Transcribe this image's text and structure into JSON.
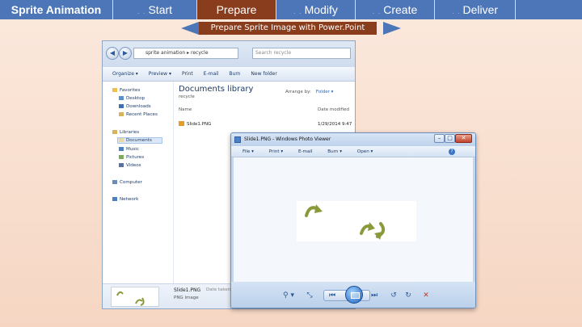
{
  "nav": {
    "title": "Sprite Animation",
    "tabs": [
      {
        "label": "Start",
        "active": false
      },
      {
        "label": "Prepare",
        "active": true
      },
      {
        "label": "Modify",
        "active": false
      },
      {
        "label": "Create",
        "active": false
      },
      {
        "label": "Deliver",
        "active": false
      }
    ],
    "subtitle": "Prepare Sprite Image with Power.Point"
  },
  "explorer": {
    "address": "sprite animation  ▸  recycle",
    "search_placeholder": "Search recycle",
    "toolbar": [
      "Organize ▾",
      "Preview ▾",
      "Print",
      "E-mail",
      "Burn",
      "New folder"
    ],
    "favorites": "Favorites",
    "favorites_items": [
      "Desktop",
      "Downloads",
      "Recent Places"
    ],
    "libraries": "Libraries",
    "libraries_items": [
      "Documents",
      "Music",
      "Pictures",
      "Videos"
    ],
    "computer": "Computer",
    "network": "Network",
    "library_title": "Documents library",
    "library_sub": "recycle",
    "arrange_label": "Arrange by:",
    "arrange_value": "Folder ▾",
    "col_name": "Name",
    "col_date": "Date modified",
    "file_name": "Slide1.PNG",
    "file_date": "1/29/2014 9:47",
    "detail_name": "Slide1.PNG",
    "detail_type": "PNG image",
    "detail_meta": "Date taken:  Specify date taken"
  },
  "viewer": {
    "title": "Slide1.PNG - Windows Photo Viewer",
    "menu": [
      "File ▾",
      "Print ▾",
      "E-mail",
      "Burn ▾",
      "Open ▾"
    ],
    "help": "?",
    "controls": {
      "zoom": "⚲ ▾",
      "fit": "⤡",
      "prev": "⏮",
      "next": "⏭",
      "rotate_ccw": "↺",
      "rotate_cw": "↻",
      "delete": "✕"
    },
    "accent_delete": "#c0392b"
  },
  "colors": {
    "nav_bg": "#4c76b8",
    "nav_active": "#8a3d1c",
    "page_bg": "#f6d6c3",
    "sprite_green": "#8a9a3a"
  }
}
